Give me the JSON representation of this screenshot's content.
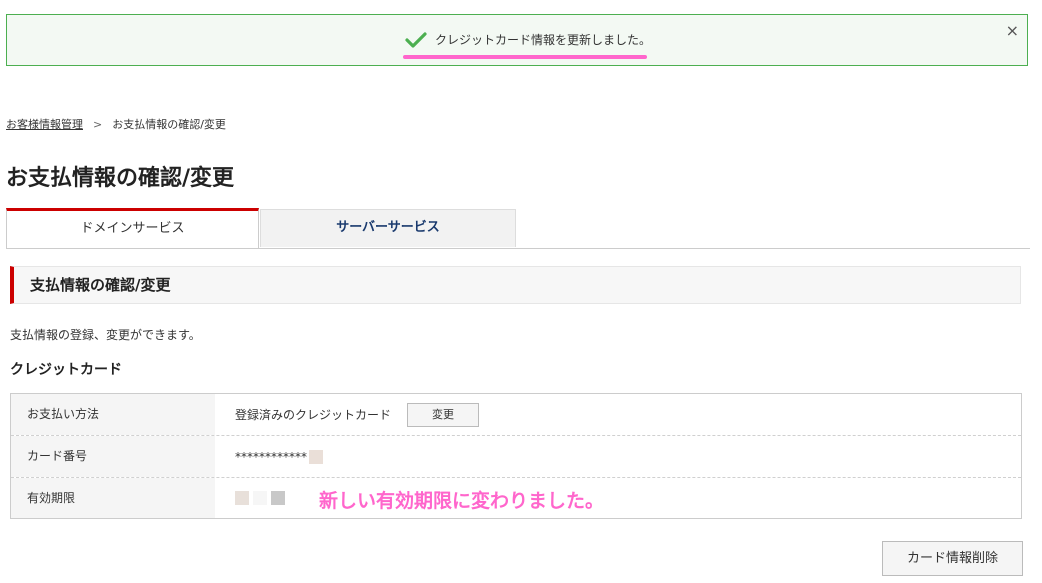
{
  "alert": {
    "message": "クレジットカード情報を更新しました。",
    "close_label": "×",
    "success_color": "#4caf50",
    "highlight_color": "#ff66cc"
  },
  "breadcrumb": {
    "link_label": "お客様情報管理",
    "separator": ">",
    "current": "お支払情報の確認/変更"
  },
  "page": {
    "title": "お支払情報の確認/変更"
  },
  "tabs": [
    {
      "label": "ドメインサービス",
      "active": true
    },
    {
      "label": "サーバーサービス",
      "active": false
    }
  ],
  "section": {
    "heading": "支払情報の確認/変更",
    "description": "支払情報の登録、変更ができます。",
    "subheading": "クレジットカード"
  },
  "table": {
    "rows": [
      {
        "label": "お支払い方法",
        "value": "登録済みのクレジットカード",
        "button": "変更"
      },
      {
        "label": "カード番号",
        "value": "************"
      },
      {
        "label": "有効期限",
        "value": ""
      }
    ],
    "annotation": "新しい有効期限に変わりました。"
  },
  "actions": {
    "delete_label": "カード情報削除"
  },
  "accent_color": "#cc0000"
}
